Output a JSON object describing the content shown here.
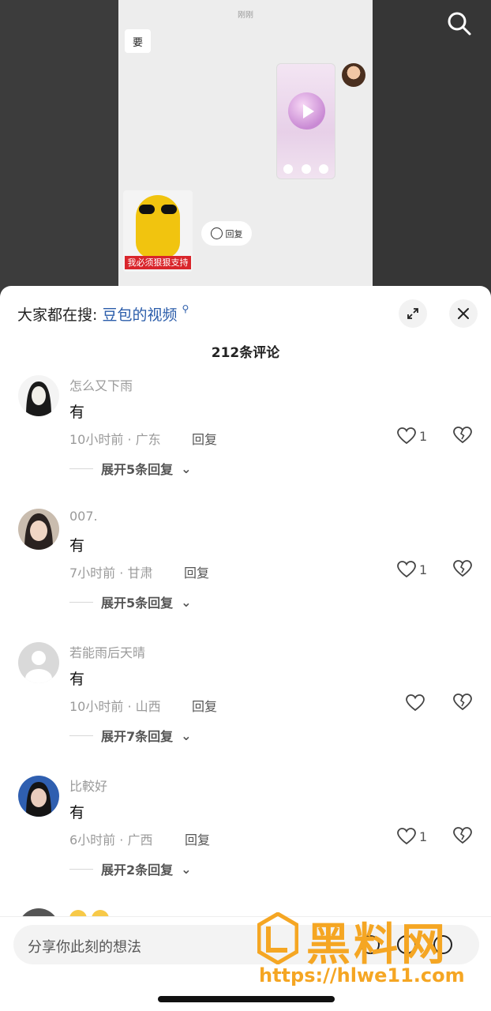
{
  "video": {
    "chat_time": "刚刚",
    "bubble_text": "要",
    "sticker_caption": "我必须狠狠支持",
    "reply_chip_label": "回复"
  },
  "sheet": {
    "search_prefix": "大家都在搜:",
    "search_keyword": "豆包的视频",
    "comment_count_title": "212条评论"
  },
  "comments": [
    {
      "user": "怎么又下雨",
      "text": "有",
      "meta": "10小时前 · 广东",
      "reply": "回复",
      "likes": "1",
      "expand": "展开5条回复"
    },
    {
      "user": "007.",
      "text": "有",
      "meta": "7小时前 · 甘肃",
      "reply": "回复",
      "likes": "1",
      "expand": "展开5条回复"
    },
    {
      "user": "若能雨后天晴",
      "text": "有",
      "meta": "10小时前 · 山西",
      "reply": "回复",
      "likes": "",
      "expand": "展开7条回复"
    },
    {
      "user": "比較好",
      "text": "有",
      "meta": "6小时前 · 广西",
      "reply": "回复",
      "likes": "1",
      "expand": "展开2条回复"
    }
  ],
  "input": {
    "placeholder": "分享你此刻的想法"
  },
  "watermark": {
    "title": "黑料网",
    "url": "https://hlwe11.com"
  },
  "colors": {
    "accent_link": "#2a5caa",
    "watermark": "#f5a623",
    "sticker_red": "#d9252b"
  }
}
